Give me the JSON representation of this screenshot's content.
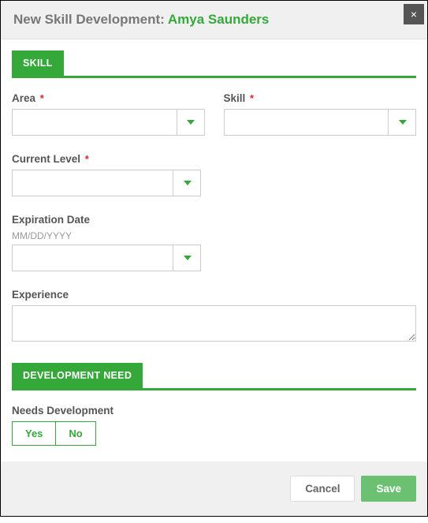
{
  "header": {
    "title_prefix": "New Skill Development: ",
    "person_name": "Amya Saunders"
  },
  "sections": {
    "skill_tab": "SKILL",
    "dev_tab": "DEVELOPMENT NEED"
  },
  "fields": {
    "area": {
      "label": "Area",
      "required": true,
      "value": ""
    },
    "skill": {
      "label": "Skill",
      "required": true,
      "value": ""
    },
    "current_level": {
      "label": "Current Level",
      "required": true,
      "value": ""
    },
    "expiration_date": {
      "label": "Expiration Date",
      "hint": "MM/DD/YYYY",
      "value": ""
    },
    "experience": {
      "label": "Experience",
      "value": ""
    },
    "needs_dev": {
      "label": "Needs Development",
      "options": {
        "yes": "Yes",
        "no": "No"
      }
    }
  },
  "footer": {
    "cancel": "Cancel",
    "save": "Save"
  },
  "required_marker": "*"
}
